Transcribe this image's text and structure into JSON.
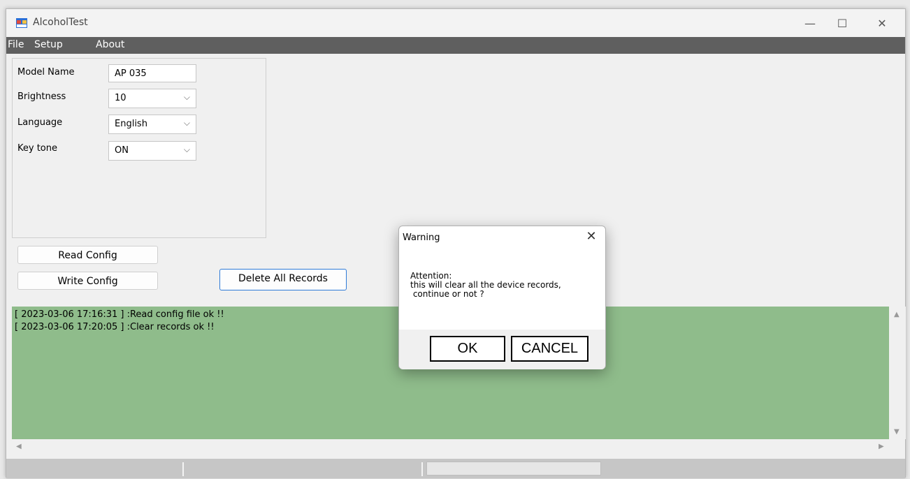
{
  "window": {
    "title": "AlcoholTest",
    "minimize": "—",
    "maximize": "☐",
    "close": "✕"
  },
  "menu": [
    "File",
    "Setup",
    "About"
  ],
  "config": {
    "model_label": "Model Name",
    "model_value": "AP 035",
    "brightness_label": "Brightness",
    "brightness_value": "10",
    "language_label": "Language",
    "language_value": "English",
    "keytone_label": "Key tone",
    "keytone_value": "ON"
  },
  "buttons": {
    "read": "Read Config",
    "write": "Write Config",
    "delete": "Delete All Records"
  },
  "log": [
    "[ 2023-03-06 17:16:31 ] :Read config file ok !!",
    "[ 2023-03-06 17:20:05 ] :Clear records ok !!"
  ],
  "dialog": {
    "title": "Warning",
    "close": "✕",
    "message": [
      "Attention:",
      "this will clear all the device records,",
      " continue or not ?"
    ],
    "ok": "OK",
    "cancel": "CANCEL"
  },
  "icons": {
    "app": "app-window-icon",
    "dropdown": "chevron-down-icon",
    "scroll_up": "▲",
    "scroll_down": "▼",
    "scroll_left": "◀",
    "scroll_right": "▶"
  },
  "colors": {
    "log_bg": "#8fbc8b",
    "menubar": "#5f5f5f",
    "accent": "#2f7bd8"
  }
}
